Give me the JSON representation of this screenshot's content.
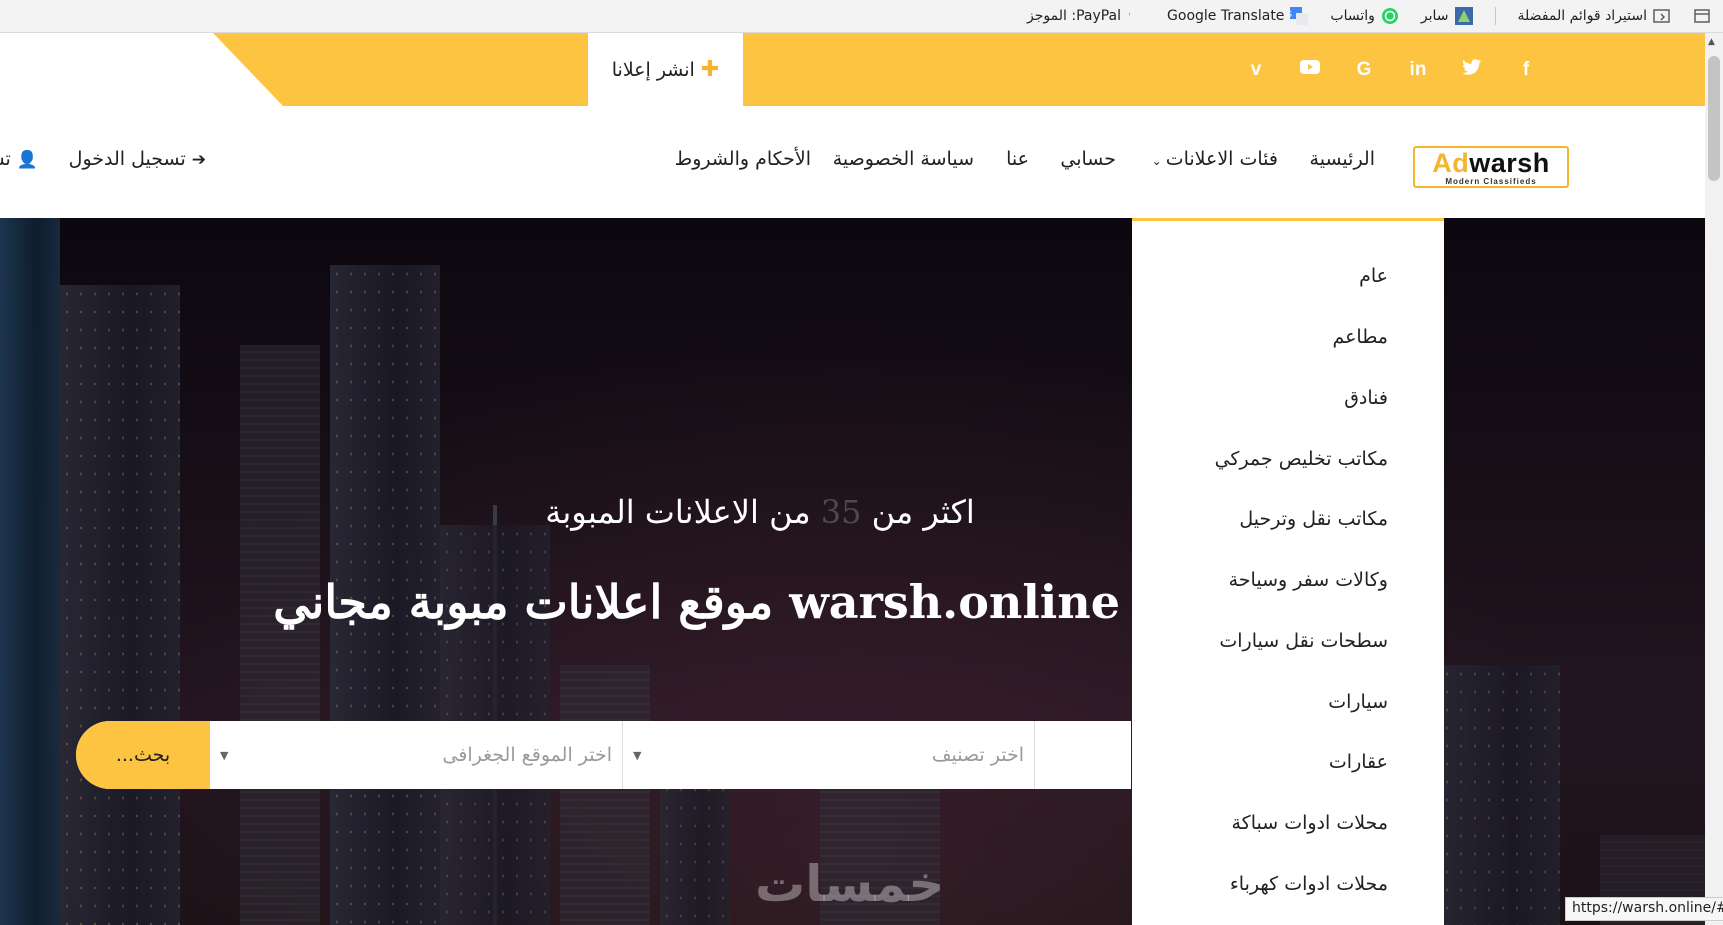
{
  "bookmarks": {
    "import": "استيراد قوائم المفضلة",
    "items": [
      {
        "label": "سابر",
        "icon": "saber-icon"
      },
      {
        "label": "واتساب",
        "icon": "whatsapp-icon"
      },
      {
        "label": "Google Translate",
        "icon": "google-translate-icon"
      },
      {
        "label": "PayPal: الموجز",
        "icon": "paypal-icon"
      }
    ]
  },
  "topbar": {
    "post_ad": "انشر إعلانا",
    "social": [
      "facebook-icon",
      "twitter-icon",
      "linkedin-icon",
      "google-icon",
      "youtube-icon",
      "vimeo-icon"
    ],
    "social_glyphs": [
      "f",
      "🐦",
      "in",
      "G",
      "▶",
      "v"
    ]
  },
  "logo": {
    "ad": "Ad",
    "warsh": "warsh",
    "tagline": "Modern Classifieds"
  },
  "nav": {
    "home": "الرئيسية",
    "categories": "فئات الاعلانات",
    "account": "حسابي",
    "about": "عنا",
    "privacy": "سياسة الخصوصية",
    "terms": "الأحكام والشروط",
    "login": "تسجيل الدخول",
    "register": "تس"
  },
  "hero": {
    "subtitle_prefix": "اكثر من",
    "subtitle_number": "35",
    "subtitle_suffix": "من الاعلانات المبوبة",
    "title": "warsh.online موقع اعلانات مبوبة مجاني"
  },
  "search": {
    "button": "بحث...",
    "category_placeholder": "اختر تصنيف",
    "location_placeholder": "اختر الموقع الجغرافى"
  },
  "dropdown": {
    "items": [
      "عام",
      "مطاعم",
      "فنادق",
      "مكاتب تخليص جمركي",
      "مكاتب نقل وترحيل",
      "وكالات سفر وسياحة",
      "سطحات نقل سيارات",
      "سيارات",
      "عقارات",
      "محلات ادوات سباكة",
      "محلات ادوات كهرباء"
    ]
  },
  "watermark": "خمسات",
  "status_url": "https://warsh.online/#",
  "colors": {
    "accent": "#fcc440",
    "dark": "#222222"
  }
}
